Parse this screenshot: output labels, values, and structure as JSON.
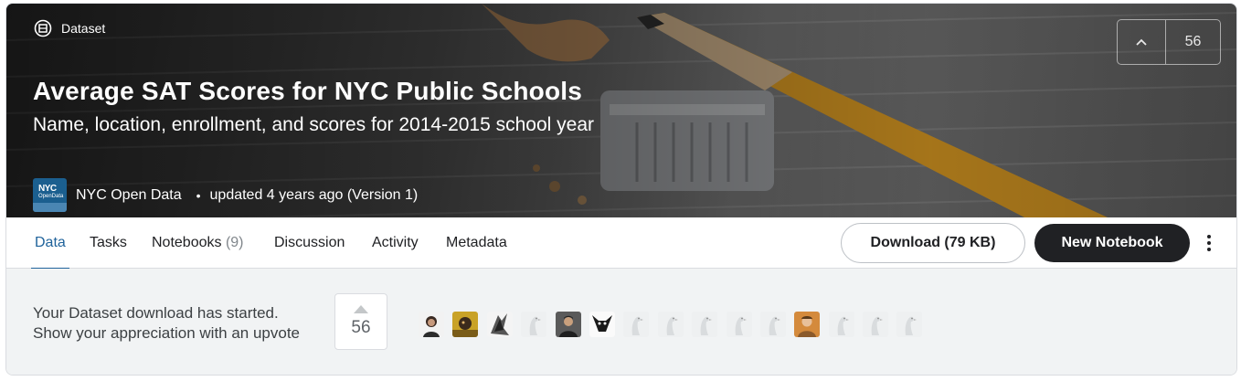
{
  "hero": {
    "tag": "Dataset",
    "title": "Average SAT Scores for NYC Public Schools",
    "subtitle": "Name, location, enrollment, and scores for 2014-2015 school year",
    "owner": "NYC Open Data",
    "owner_logo_text": [
      "NYC",
      "OpenData"
    ],
    "updated": "updated 4 years ago (Version 1)",
    "upvotes": "56"
  },
  "tabs": [
    {
      "label": "Data",
      "active": true
    },
    {
      "label": "Tasks"
    },
    {
      "label": "Notebooks",
      "count": "(9)"
    },
    {
      "label": "Discussion"
    },
    {
      "label": "Activity"
    },
    {
      "label": "Metadata"
    }
  ],
  "actions": {
    "download": "Download (79 KB)",
    "new_notebook": "New Notebook",
    "more": "more-vert-icon"
  },
  "notice": {
    "line1": "Your Dataset download has started.",
    "line2": "Show your appreciation with an upvote",
    "upvotes": "56"
  },
  "voters": [
    {
      "type": "photo-woman"
    },
    {
      "type": "photo-yellow"
    },
    {
      "type": "sketch"
    },
    {
      "type": "default"
    },
    {
      "type": "photo-man"
    },
    {
      "type": "dog"
    },
    {
      "type": "default"
    },
    {
      "type": "default"
    },
    {
      "type": "default"
    },
    {
      "type": "default"
    },
    {
      "type": "default"
    },
    {
      "type": "photo-warm"
    },
    {
      "type": "default"
    },
    {
      "type": "default"
    },
    {
      "type": "default"
    }
  ],
  "colors": {
    "accent": "#20639b",
    "button_dark": "#202124",
    "notice_bg": "#f1f3f4"
  }
}
